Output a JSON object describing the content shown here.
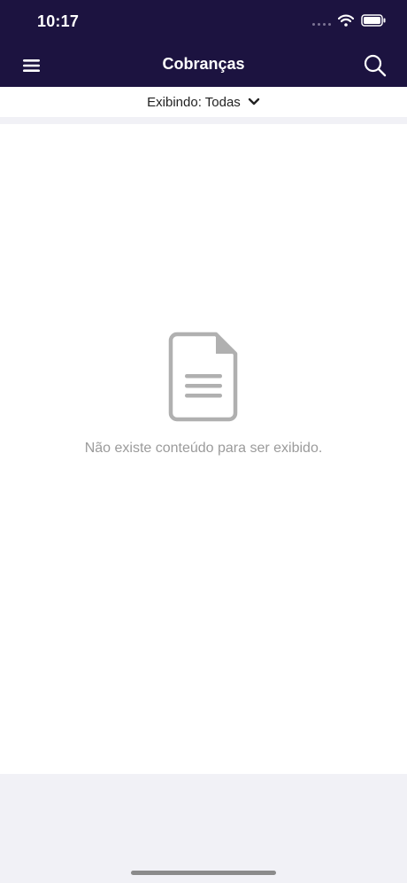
{
  "status_bar": {
    "time": "10:17"
  },
  "header": {
    "title": "Cobranças"
  },
  "filter": {
    "label": "Exibindo: Todas"
  },
  "empty_state": {
    "message": "Não existe conteúdo para ser exibido."
  },
  "icons": {
    "menu": "hamburger-menu-icon",
    "search": "search-icon",
    "filter": "chevron-down-icon",
    "empty": "document-icon"
  },
  "colors": {
    "header_bg": "#1c1340",
    "header_text": "#ffffff",
    "muted_text": "#9b9b9b",
    "icon_gray": "#b0b0b0",
    "footer_bg": "#f1f1f6"
  }
}
